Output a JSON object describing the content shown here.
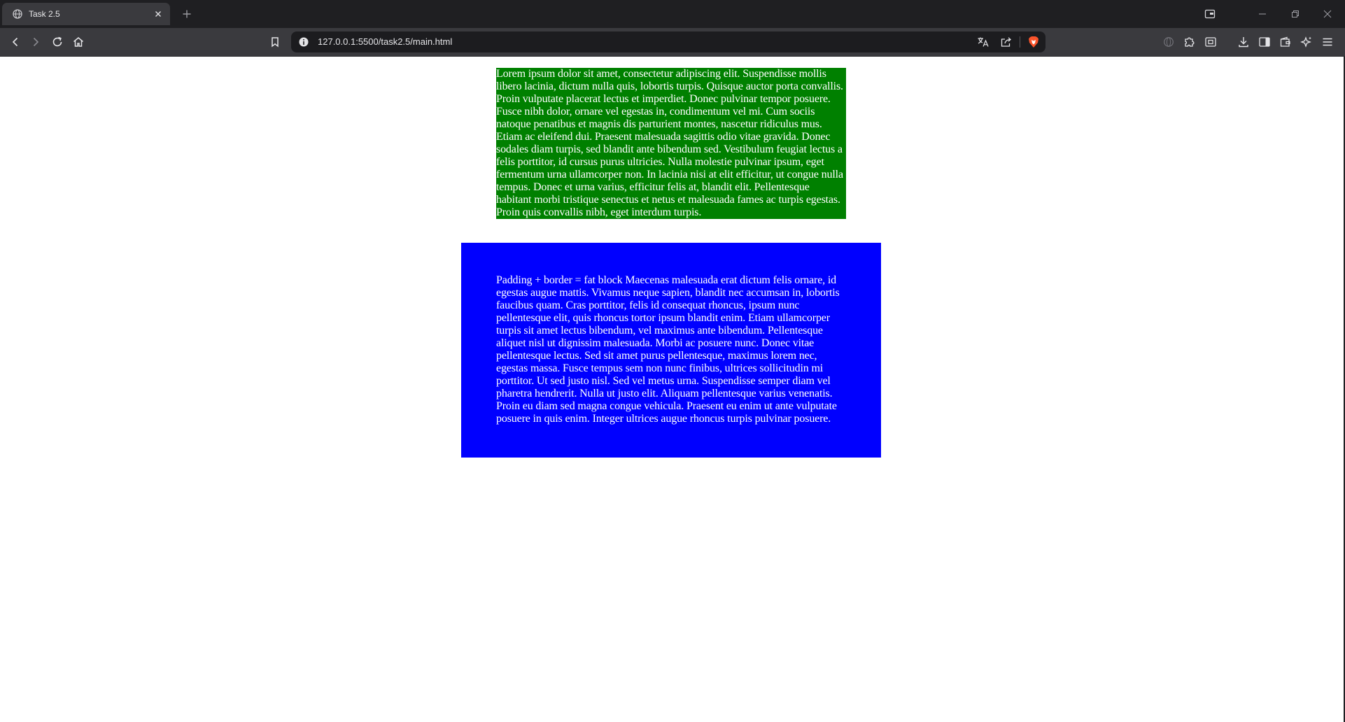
{
  "browser": {
    "tab": {
      "title": "Task 2.5",
      "favicon": "globe-icon"
    },
    "address_bar": {
      "url": "127.0.0.1:5500/task2.5/main.html"
    },
    "icons": {
      "back": "back-arrow-icon",
      "forward": "forward-arrow-icon",
      "reload": "reload-icon",
      "home": "home-icon",
      "bookmark": "bookmark-icon",
      "site_info": "info-icon",
      "translate": "translate-icon",
      "share": "share-icon",
      "brave_shields": "brave-lion-icon",
      "extensions": "puzzle-icon",
      "downloads": "download-icon",
      "sidebar": "sidebar-icon",
      "wallet": "wallet-icon",
      "leo": "leo-sparkle-icon",
      "menu": "hamburger-menu-icon"
    },
    "colors": {
      "tabstrip_bg": "#1f1f22",
      "toolbar_bg": "#3a3a3e",
      "urlbar_bg": "#1c1c1f",
      "brave_orange": "#fb542b"
    }
  },
  "page": {
    "green_box": {
      "text": "Lorem ipsum dolor sit amet, consectetur adipiscing elit. Suspendisse mollis libero lacinia, dictum nulla quis, lobortis turpis. Quisque auctor porta convallis. Proin vulputate placerat lectus et imperdiet. Donec pulvinar tempor posuere. Fusce nibh dolor, ornare vel egestas in, condimentum vel mi. Cum sociis natoque penatibus et magnis dis parturient montes, nascetur ridiculus mus. Etiam ac eleifend dui. Praesent malesuada sagittis odio vitae gravida. Donec sodales diam turpis, sed blandit ante bibendum sed. Vestibulum feugiat lectus a felis porttitor, id cursus purus ultricies. Nulla molestie pulvinar ipsum, eget fermentum urna ullamcorper non. In lacinia nisi at elit efficitur, ut congue nulla tempus. Donec et urna varius, efficitur felis at, blandit elit. Pellentesque habitant morbi tristique senectus et netus et malesuada fames ac turpis egestas. Proin quis convallis nibh, eget interdum turpis.",
      "color": "#008000"
    },
    "blue_box": {
      "text": "Padding + border = fat block Maecenas malesuada erat dictum felis ornare, id egestas augue mattis. Vivamus neque sapien, blandit nec accumsan in, lobortis faucibus quam. Cras porttitor, felis id consequat rhoncus, ipsum nunc pellentesque elit, quis rhoncus tortor ipsum blandit enim. Etiam ullamcorper turpis sit amet lectus bibendum, vel maximus ante bibendum. Pellentesque aliquet nisl ut dignissim malesuada. Morbi ac posuere nunc. Donec vitae pellentesque lectus. Sed sit amet purus pellentesque, maximus lorem nec, egestas massa. Fusce tempus sem non nunc finibus, ultrices sollicitudin mi porttitor. Ut sed justo nisl. Sed vel metus urna. Suspendisse semper diam vel pharetra hendrerit. Nulla ut justo elit. Aliquam pellentesque varius venenatis. Proin eu diam sed magna congue vehicula. Praesent eu enim ut ante vulputate posuere in quis enim. Integer ultrices augue rhoncus turpis pulvinar posuere.",
      "color": "#0000ff"
    }
  }
}
